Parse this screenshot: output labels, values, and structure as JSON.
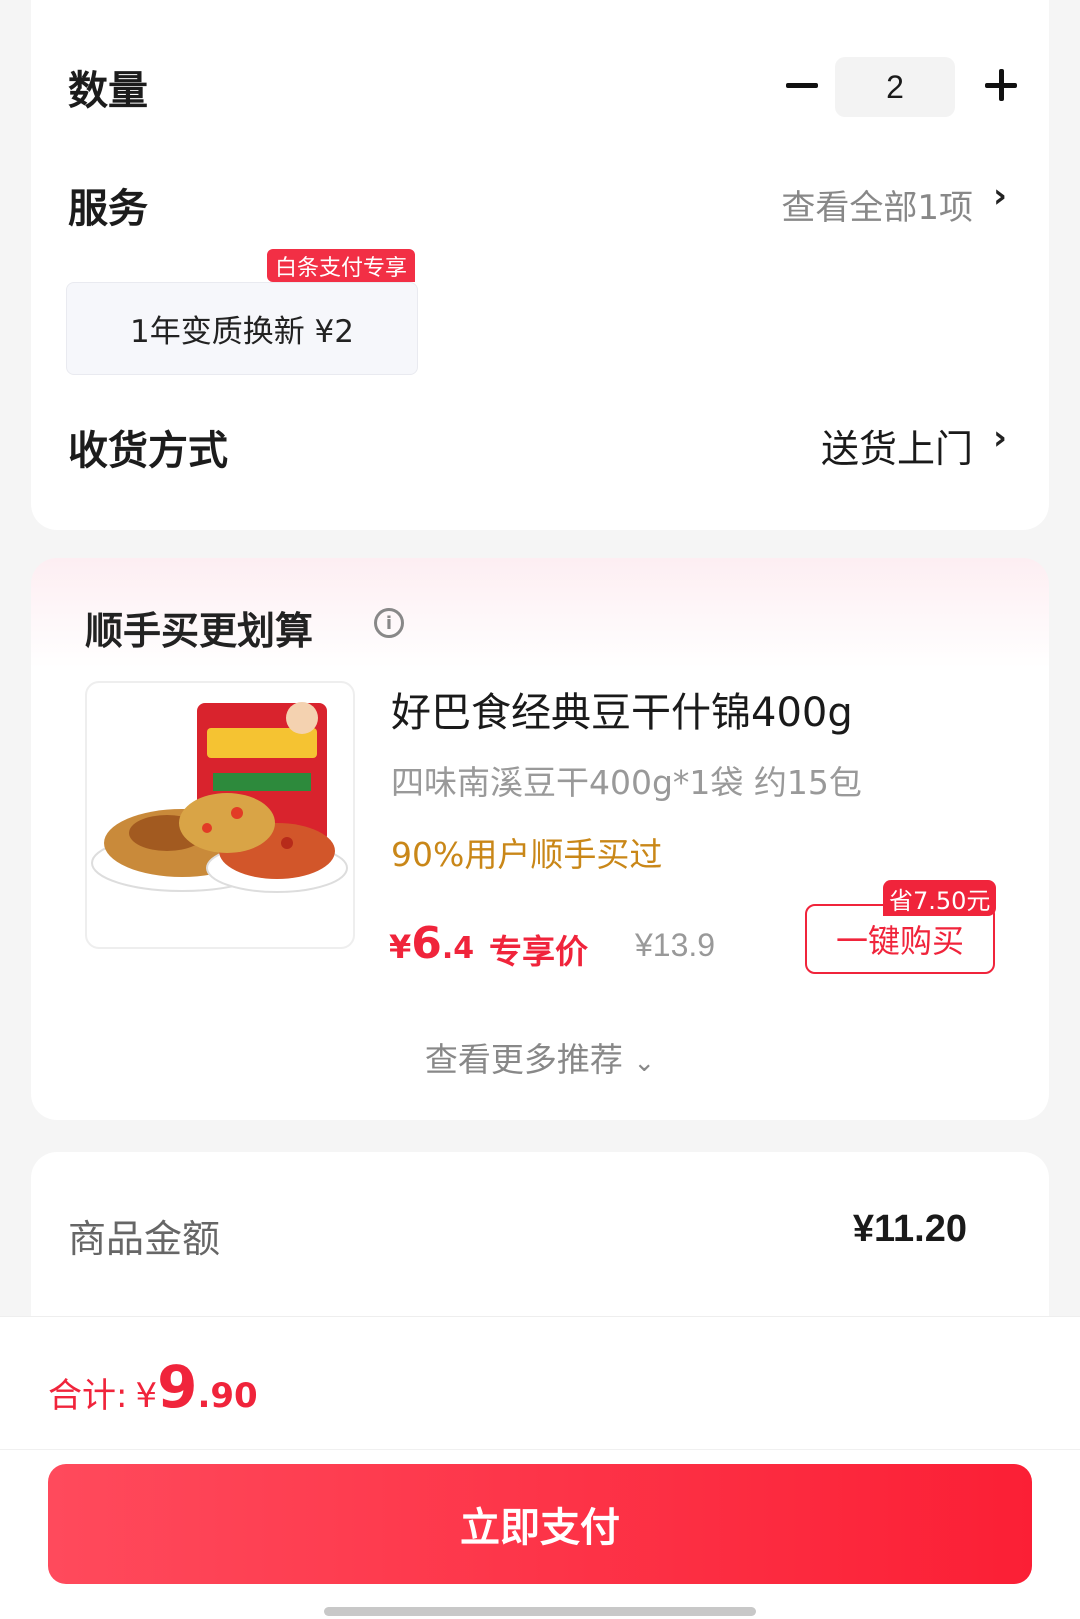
{
  "options": {
    "quantity_label": "数量",
    "quantity_value": "2",
    "service_label": "服务",
    "service_link": "查看全部1项",
    "service_item": "1年变质换新  ¥2",
    "service_tag": "白条支付专享",
    "delivery_label": "收货方式",
    "delivery_value": "送货上门"
  },
  "recommend": {
    "title": "顺手买更划算",
    "product": {
      "name": "好巴食经典豆干什锦400g",
      "spec": "四味南溪豆干400g*1袋 约15包",
      "rate": "90%用户顺手买过",
      "price_symbol": "¥",
      "price_int": "6",
      "price_dec": ".4",
      "exclusive_label": "专享价",
      "original_price": "¥13.9",
      "save_tag": "省7.50元",
      "buy_label": "一键购买"
    },
    "more_label": "查看更多推荐"
  },
  "summary": {
    "goods_label": "商品金额",
    "goods_value": "¥11.20"
  },
  "bottom": {
    "total_label": "合计:",
    "total_symbol": "¥",
    "total_int": "9",
    "total_dec": ".90",
    "pay_label": "立即支付"
  },
  "colors": {
    "accent_red": "#f0243b",
    "rate_orange": "#c98718"
  }
}
